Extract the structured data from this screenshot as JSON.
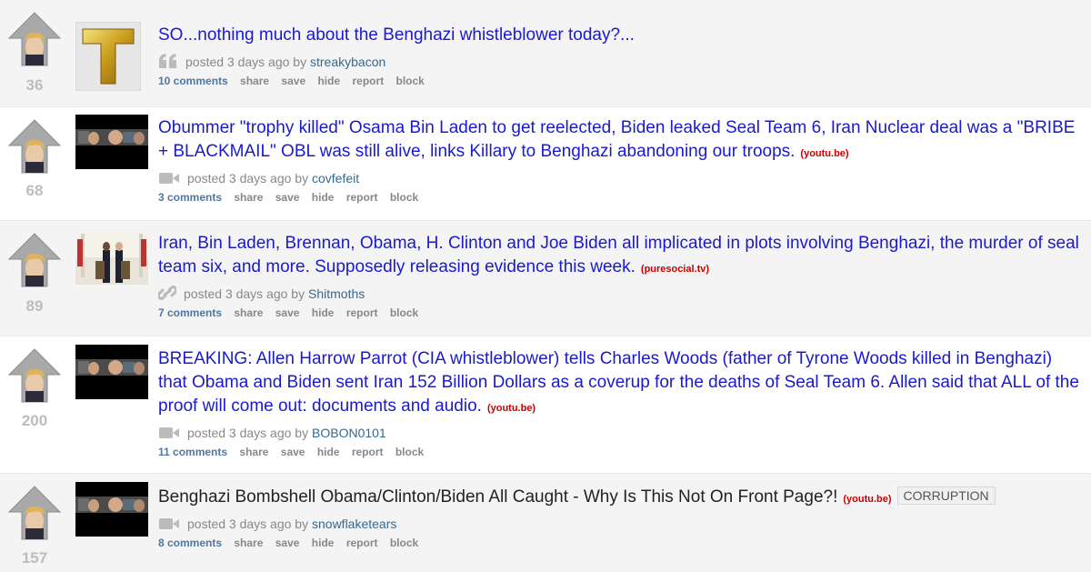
{
  "posts": [
    {
      "score": "36",
      "title": "SO...nothing much about the Benghazi whistleblower today?...",
      "domain": "",
      "flair": "",
      "posted": "posted 3 days ago by",
      "author": "streakybacon",
      "comments": "10 comments",
      "type_icon": "quote-icon",
      "thumb": "gold-letter-t-thumbnail"
    },
    {
      "score": "68",
      "title": "Obummer \"trophy killed\" Osama Bin Laden to get reelected, Biden leaked Seal Team 6, Iran Nuclear deal was a \"BRIBE + BLACKMAIL\" OBL was still alive, links Killary to Benghazi abandoning our troops.",
      "domain": "(youtu.be)",
      "flair": "",
      "posted": "posted 3 days ago by",
      "author": "covfefeit",
      "comments": "3 comments",
      "type_icon": "video-icon",
      "thumb": "video-thumbnail"
    },
    {
      "score": "89",
      "title": "Iran, Bin Laden, Brennan, Obama, H. Clinton and Joe Biden all implicated in plots involving Benghazi, the murder of seal team six, and more. Supposedly releasing evidence this week.",
      "domain": "(puresocial.tv)",
      "flair": "",
      "posted": "posted 3 days ago by",
      "author": "Shitmoths",
      "comments": "7 comments",
      "type_icon": "link-icon",
      "thumb": "press-conference-thumbnail"
    },
    {
      "score": "200",
      "title": "BREAKING: Allen Harrow Parrot (CIA whistleblower) tells Charles Woods (father of Tyrone Woods killed in Benghazi) that Obama and Biden sent Iran 152 Billion Dollars as a coverup for the deaths of Seal Team 6. Allen said that ALL of the proof will come out: documents and audio.",
      "domain": "(youtu.be)",
      "flair": "",
      "posted": "posted 3 days ago by",
      "author": "BOBON0101",
      "comments": "11 comments",
      "type_icon": "video-icon",
      "thumb": "video-thumbnail"
    },
    {
      "score": "157",
      "title": "Benghazi Bombshell Obama/Clinton/Biden All Caught - Why Is This Not On Front Page?!",
      "domain": "(youtu.be)",
      "flair": "CORRUPTION",
      "posted": "posted 3 days ago by",
      "author": "snowflaketears",
      "comments": "8 comments",
      "type_icon": "video-icon",
      "thumb": "video-thumbnail"
    }
  ],
  "actions": {
    "share": "share",
    "save": "save",
    "hide": "hide",
    "report": "report",
    "block": "block"
  },
  "colors": {
    "title_link": "#1a1acc",
    "domain": "#cc0000",
    "author": "#36698f",
    "comments": "#4f77a3",
    "score": "#bdbdbd"
  }
}
